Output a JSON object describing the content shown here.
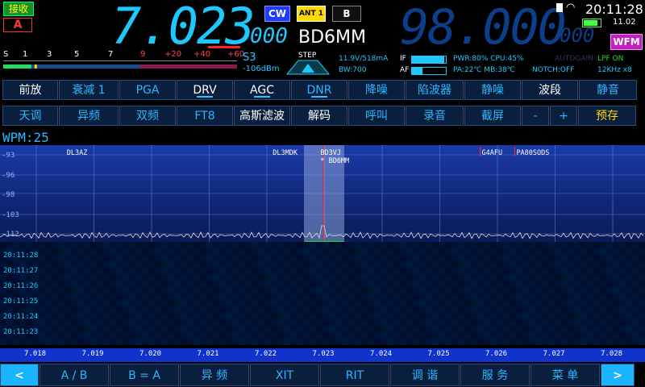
{
  "status": {
    "rx_label": "接收",
    "vfo_label": "A",
    "mode": "CW",
    "antenna": "ANT 1",
    "band_mode": "B",
    "wfm_label": "WFM",
    "clock": "20:11:28",
    "date": "11.02"
  },
  "frequency": {
    "main_big": "7.023",
    "main_small": "000",
    "callsign": "BD6MM",
    "sub_big": "98.000",
    "sub_small": "000"
  },
  "meter": {
    "scale": [
      "S",
      "1",
      "3",
      "5",
      "7",
      "9",
      "+20",
      "+40",
      "+60"
    ],
    "s_reading": "S3",
    "dbm": "-106dBm",
    "level": 0.12
  },
  "step": {
    "label": "STEP"
  },
  "info": {
    "volt": "11.9V/518mA",
    "bw": "BW:700",
    "if_label": "IF",
    "af_label": "AF",
    "if_level": 0.95,
    "af_level": 0.3,
    "pwr": "PWR:80% CPU:45%",
    "autogain": "AUTOGAIN",
    "pa": "PA:22℃ MB:38℃",
    "notch": "NOTCH:OFF",
    "lpf": "LPF ON",
    "khz": "12KHz x8"
  },
  "row1": [
    {
      "label": "前放",
      "style": "white"
    },
    {
      "label": "衰减 1",
      "style": "blue"
    },
    {
      "label": "PGA",
      "style": "blue"
    },
    {
      "label": "DRV",
      "style": "white",
      "indicator": true
    },
    {
      "label": "AGC",
      "style": "white",
      "indicator": true
    },
    {
      "label": "DNR",
      "style": "blue",
      "indicator": true
    },
    {
      "label": "降噪",
      "style": "blue"
    },
    {
      "label": "陷波器",
      "style": "blue"
    },
    {
      "label": "静噪",
      "style": "blue"
    },
    {
      "label": "波段",
      "style": "white"
    },
    {
      "label": "静音",
      "style": "blue"
    }
  ],
  "row2": [
    {
      "label": "天调",
      "style": "blue"
    },
    {
      "label": "异频",
      "style": "blue"
    },
    {
      "label": "双频",
      "style": "blue"
    },
    {
      "label": "FT8",
      "style": "blue"
    },
    {
      "label": "高斯滤波",
      "style": "white"
    },
    {
      "label": "解码",
      "style": "white"
    },
    {
      "label": "呼叫",
      "style": "blue"
    },
    {
      "label": "录音",
      "style": "blue"
    },
    {
      "label": "截屏",
      "style": "blue"
    },
    {
      "label": "-",
      "style": "blue"
    },
    {
      "label": "+",
      "style": "blue"
    },
    {
      "label": "预存",
      "style": "yellow"
    }
  ],
  "wpm": "WPM:25",
  "spectrum": {
    "db_labels": [
      "-93",
      "-96",
      "-98",
      "-103",
      "-112"
    ],
    "stations": [
      {
        "call": "DL3AZ",
        "freq": 7.0185
      },
      {
        "call": "DL3MDK",
        "freq": 7.0222
      },
      {
        "call": "BD3VJ",
        "freq": 7.0229
      },
      {
        "call": "* BD6MM",
        "freq": 7.0229
      },
      {
        "call": "G4AFU",
        "freq": 7.0257
      },
      {
        "call": "PA80SODS",
        "freq": 7.0263
      }
    ]
  },
  "waterfall": {
    "times": [
      "20:11:28",
      "20:11:27",
      "20:11:26",
      "20:11:25",
      "20:11:24",
      "20:11:23"
    ]
  },
  "freq_scale": [
    "7.018",
    "7.019",
    "7.020",
    "7.021",
    "7.022",
    "7.023",
    "7.024",
    "7.025",
    "7.026",
    "7.027",
    "7.028"
  ],
  "bottom": [
    {
      "label": "<",
      "arrow": true
    },
    {
      "label": "A / B"
    },
    {
      "label": "B = A"
    },
    {
      "label": "异 频"
    },
    {
      "label": "XIT"
    },
    {
      "label": "RIT"
    },
    {
      "label": "调 谐"
    },
    {
      "label": "服 务"
    },
    {
      "label": "菜 单"
    },
    {
      "label": ">",
      "arrow": true
    }
  ],
  "colors": {
    "accent": "#1ec8ff",
    "panel": "#0a1f3e",
    "scale": "#1133cc"
  }
}
